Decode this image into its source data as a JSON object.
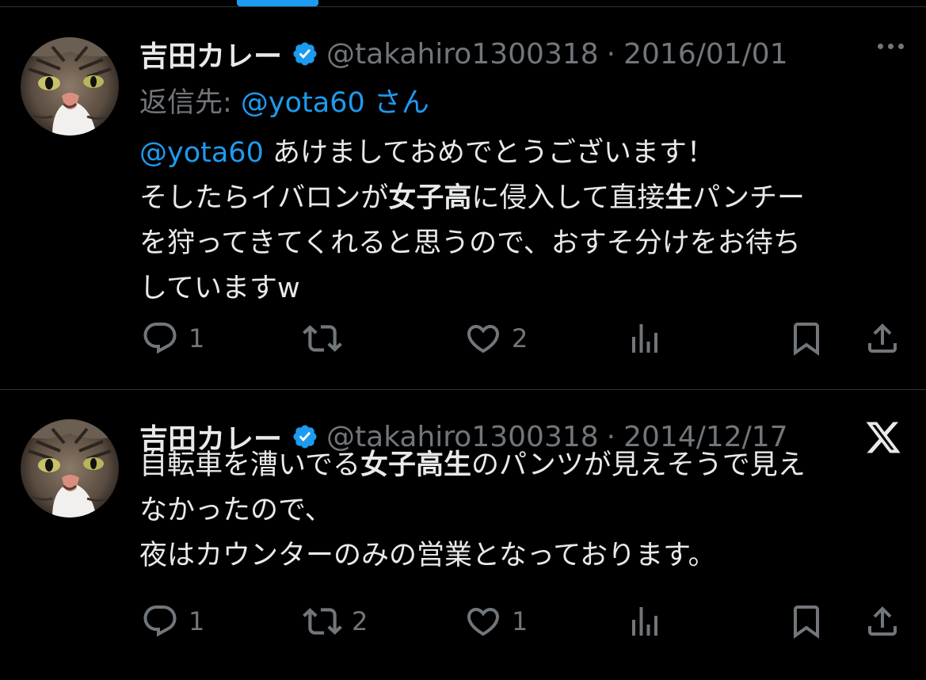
{
  "colors": {
    "background": "#000000",
    "text": "#e7e9ea",
    "muted": "#71767b",
    "accent": "#1d9bf0",
    "divider": "#2f3336"
  },
  "tweets": [
    {
      "author_name": "吉田カレー",
      "verified": true,
      "handle": "@takahiro1300318",
      "separator": "·",
      "date": "2016/01/01",
      "reply_prefix": "返信先: ",
      "reply_to": "@yota60 さん",
      "body": {
        "mention": "@yota60",
        "l1": " あけましておめでとうございます！",
        "l2a": "そしたらイバロンが",
        "l2b": "女子高",
        "l2c": "に侵入して直接",
        "l2d": "生",
        "l2e": "パンチー",
        "l3": "を狩ってきてくれると思うので、おすそ分けをお待ち",
        "l4": "していますw"
      },
      "counts": {
        "replies": "1",
        "reposts": "",
        "likes": "2",
        "views": ""
      },
      "top_right_icon": "more-icon"
    },
    {
      "author_name": "吉田カレー",
      "verified": true,
      "handle": "@takahiro1300318",
      "separator": "·",
      "date": "2014/12/17",
      "body": {
        "l1a": "自転車を漕いでる",
        "l1b": "女子高生",
        "l1c": "のパンツが見えそうで見え",
        "l2": "なかったので、",
        "l3": "夜はカウンターのみの営業となっております。"
      },
      "counts": {
        "replies": "1",
        "reposts": "2",
        "likes": "1",
        "views": ""
      },
      "top_right_icon": "x-logo-icon"
    }
  ]
}
